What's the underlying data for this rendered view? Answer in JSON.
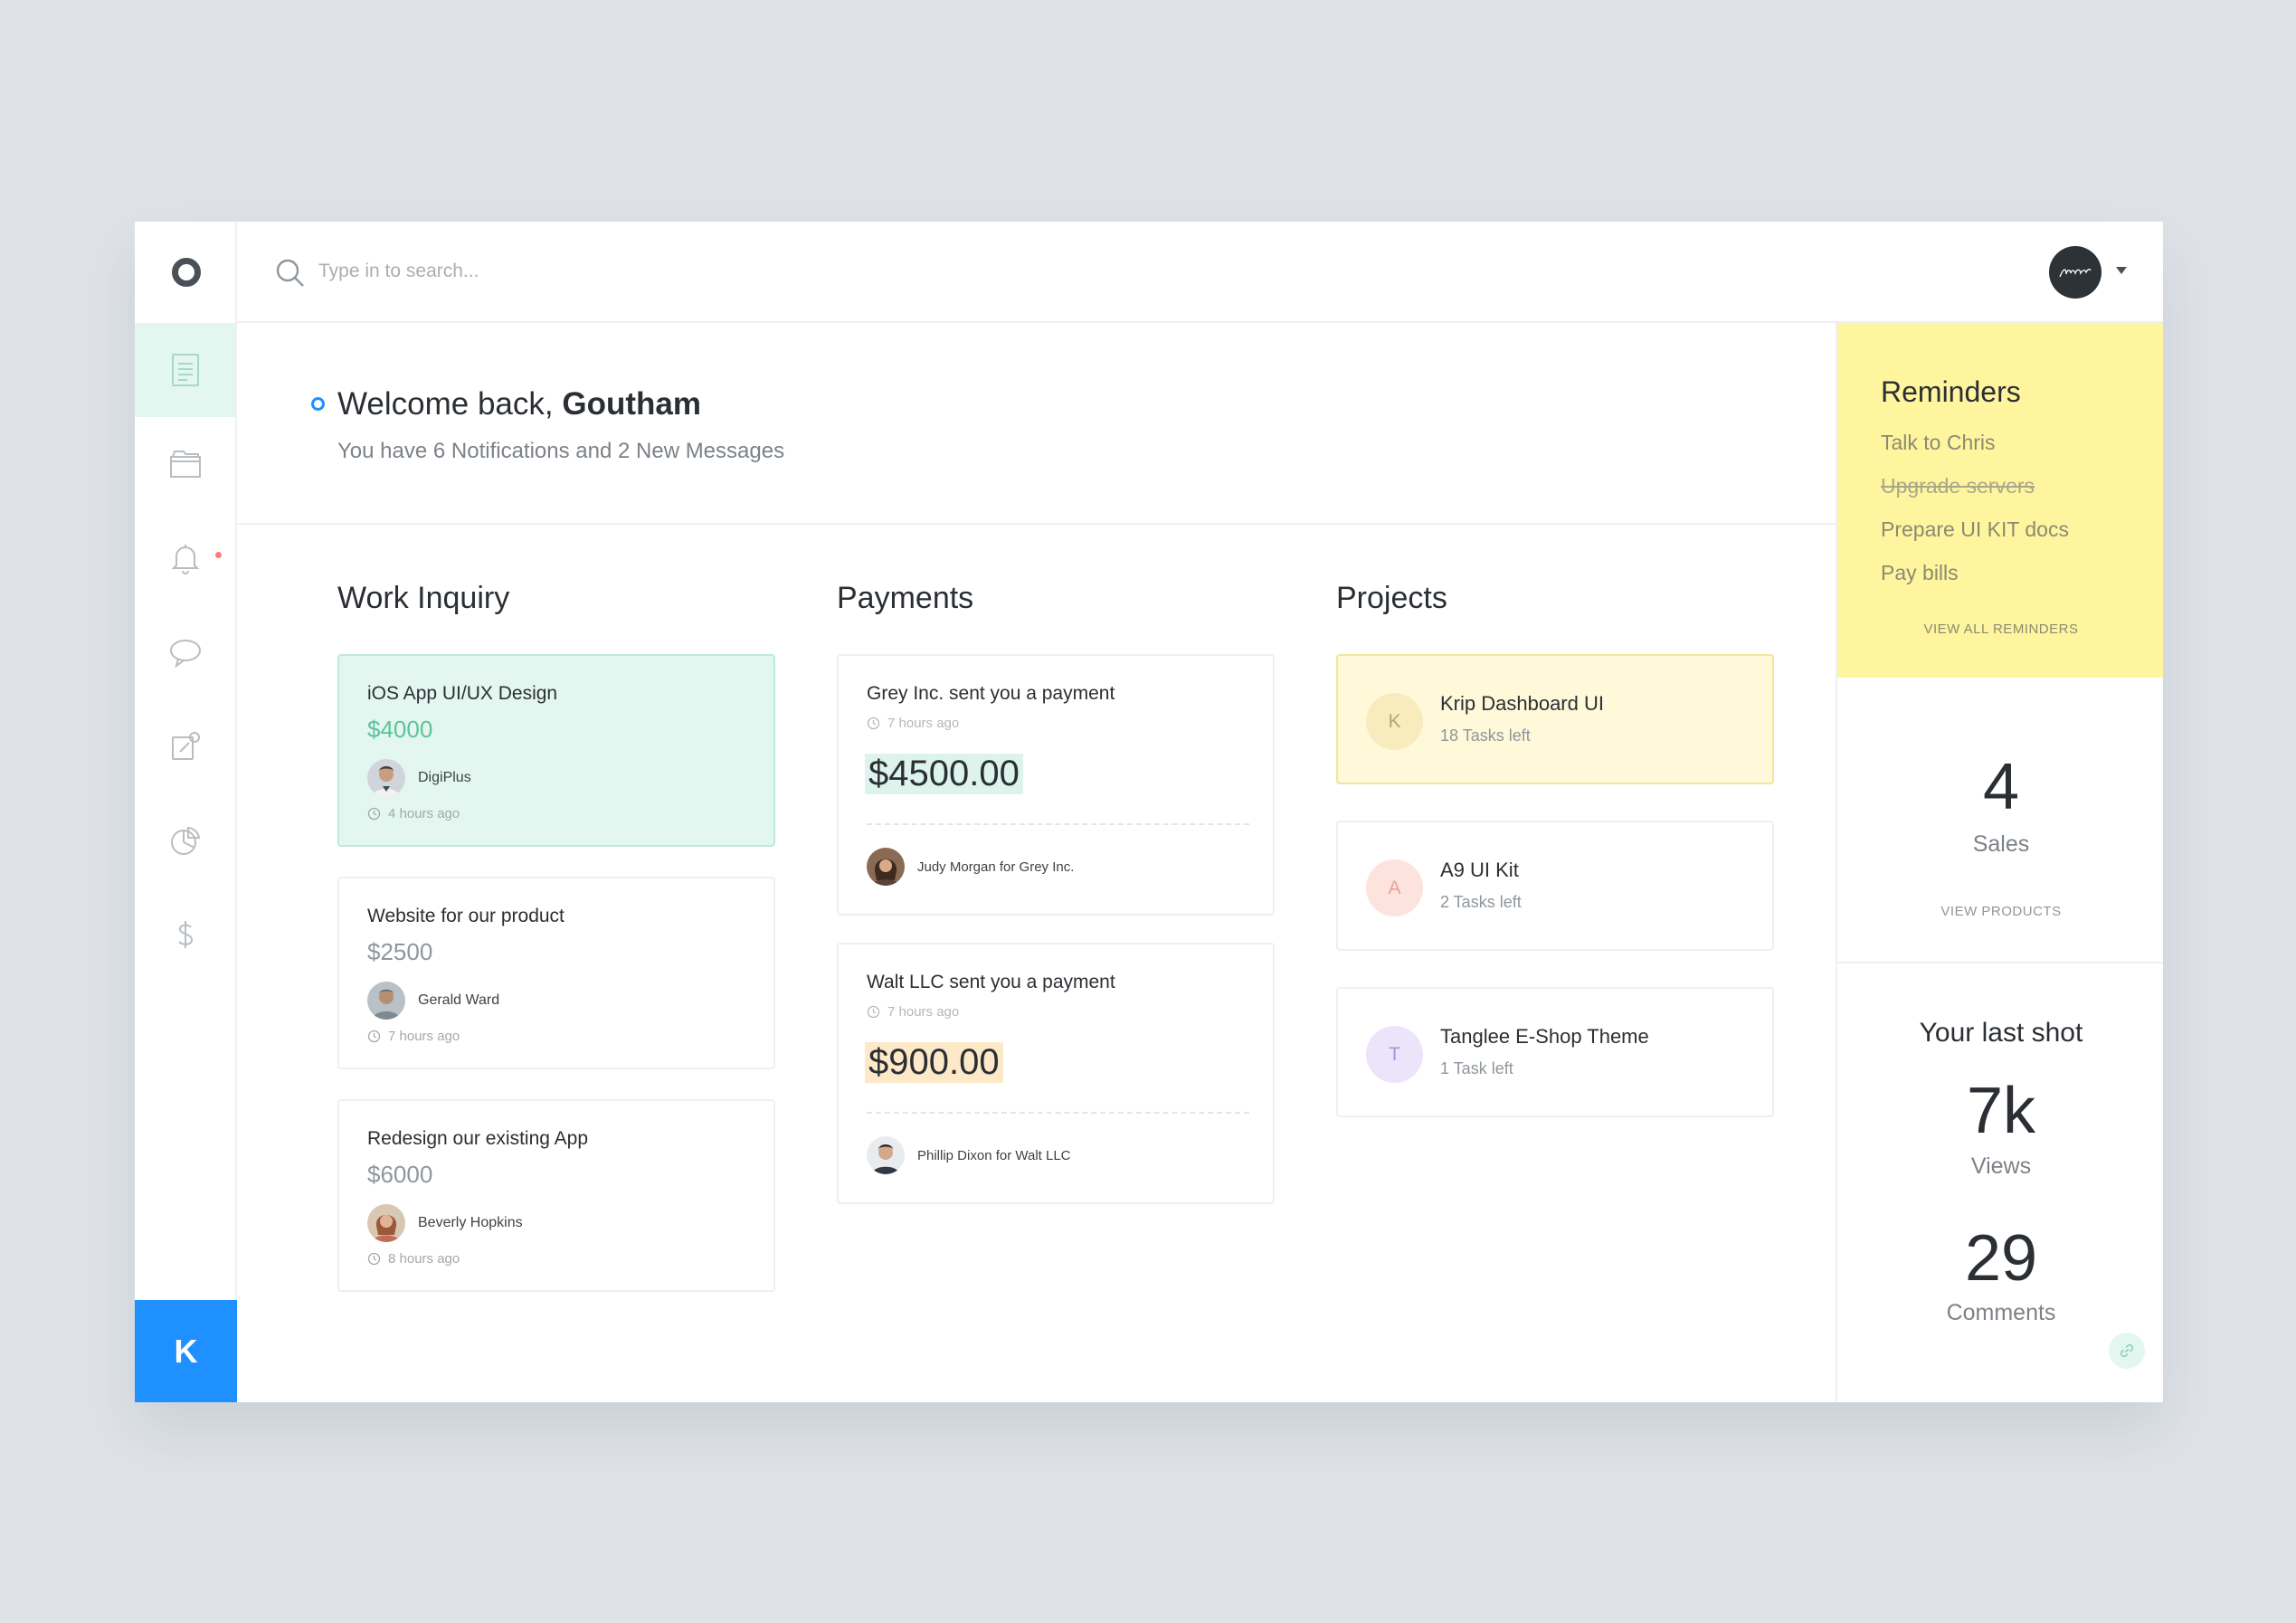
{
  "colors": {
    "accent": "#1e90ff",
    "active_nav_bg": "#e3f6ef",
    "green_amount": "#5cc39c",
    "reminders_bg": "#fff59e",
    "notification_dot": "#ff7b7b"
  },
  "sidebar": {
    "items": [
      {
        "name": "dashboard",
        "icon": "document-icon",
        "active": true
      },
      {
        "name": "files",
        "icon": "folder-icon",
        "active": false
      },
      {
        "name": "notifications",
        "icon": "bell-icon",
        "active": false
      },
      {
        "name": "messages",
        "icon": "chat-bubble-icon",
        "active": false
      },
      {
        "name": "tasks",
        "icon": "edit-icon",
        "active": false
      },
      {
        "name": "analytics",
        "icon": "pie-chart-icon",
        "active": false
      },
      {
        "name": "payments",
        "icon": "dollar-icon",
        "active": false
      }
    ],
    "user_initial": "K"
  },
  "search": {
    "placeholder": "Type in to search...",
    "value": ""
  },
  "welcome": {
    "greeting": "Welcome back,",
    "name": "Goutham",
    "subtitle": "You have 6 Notifications and 2 New Messages"
  },
  "work_inquiry": {
    "title": "Work Inquiry",
    "items": [
      {
        "title": "iOS App UI/UX Design",
        "amount": "$4000",
        "person": "DigiPlus",
        "time": "4 hours ago"
      },
      {
        "title": "Website for our product",
        "amount": "$2500",
        "person": "Gerald Ward",
        "time": "7 hours ago"
      },
      {
        "title": "Redesign our existing App",
        "amount": "$6000",
        "person": "Beverly Hopkins",
        "time": "8 hours ago"
      }
    ]
  },
  "payments": {
    "title": "Payments",
    "items": [
      {
        "title": "Grey Inc. sent you a payment",
        "time": "7 hours ago",
        "amount": "$4500.00",
        "person": "Judy Morgan for Grey Inc."
      },
      {
        "title": "Walt LLC sent you a payment",
        "time": "7 hours ago",
        "amount": "$900.00",
        "person": "Phillip Dixon for Walt LLC"
      }
    ]
  },
  "projects": {
    "title": "Projects",
    "items": [
      {
        "initial": "K",
        "name": "Krip Dashboard UI",
        "tasks": "18 Tasks left"
      },
      {
        "initial": "A",
        "name": "A9 UI Kit",
        "tasks": "2 Tasks left"
      },
      {
        "initial": "T",
        "name": "Tanglee E-Shop Theme",
        "tasks": "1 Task left"
      }
    ]
  },
  "reminders": {
    "title": "Reminders",
    "items": [
      {
        "label": "Talk to Chris",
        "done": false
      },
      {
        "label": "Upgrade servers",
        "done": true
      },
      {
        "label": "Prepare UI KIT docs",
        "done": false
      },
      {
        "label": "Pay bills",
        "done": false
      }
    ],
    "view_all": "VIEW ALL REMINDERS"
  },
  "sales": {
    "value": "4",
    "label": "Sales",
    "link": "VIEW PRODUCTS"
  },
  "last_shot": {
    "title": "Your last shot",
    "views_value": "7k",
    "views_label": "Views",
    "comments_value": "29",
    "comments_label": "Comments"
  }
}
